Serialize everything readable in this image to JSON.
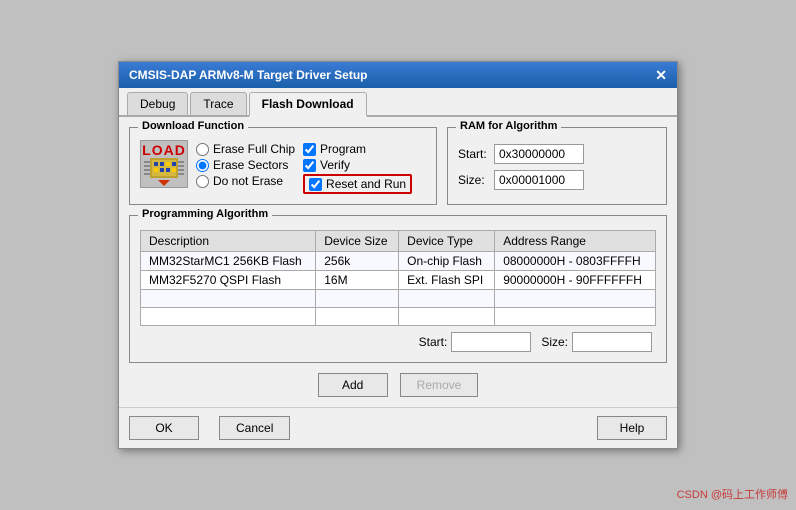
{
  "dialog": {
    "title": "CMSIS-DAP ARMv8-M Target Driver Setup",
    "close_label": "✕"
  },
  "tabs": [
    {
      "label": "Debug",
      "active": false
    },
    {
      "label": "Trace",
      "active": false
    },
    {
      "label": "Flash Download",
      "active": true
    }
  ],
  "download_function": {
    "group_label": "Download Function",
    "load_label": "LOAD",
    "radio_options": [
      {
        "id": "erase_chip",
        "label": "Erase Full Chip",
        "checked": false
      },
      {
        "id": "erase_sectors",
        "label": "Erase Sectors",
        "checked": true
      },
      {
        "id": "do_not_erase",
        "label": "Do not Erase",
        "checked": false
      }
    ],
    "checkboxes": [
      {
        "id": "program",
        "label": "Program",
        "checked": true
      },
      {
        "id": "verify",
        "label": "Verify",
        "checked": true
      }
    ],
    "reset_run": {
      "label": "Reset and Run",
      "checked": true
    }
  },
  "ram_algorithm": {
    "group_label": "RAM for Algorithm",
    "start_label": "Start:",
    "start_value": "0x30000000",
    "size_label": "Size:",
    "size_value": "0x00001000"
  },
  "programming_algorithm": {
    "group_label": "Programming Algorithm",
    "columns": [
      "Description",
      "Device Size",
      "Device Type",
      "Address Range"
    ],
    "rows": [
      {
        "description": "MM32StarMC1 256KB Flash",
        "device_size": "256k",
        "device_type": "On-chip Flash",
        "address_range": "08000000H - 0803FFFFH"
      },
      {
        "description": "MM32F5270 QSPI Flash",
        "device_size": "16M",
        "device_type": "Ext. Flash SPI",
        "address_range": "90000000H - 90FFFFFFH"
      }
    ],
    "start_label": "Start:",
    "size_label": "Size:"
  },
  "buttons": {
    "add_label": "Add",
    "remove_label": "Remove"
  },
  "footer": {
    "ok_label": "OK",
    "cancel_label": "Cancel",
    "help_label": "Help"
  },
  "watermark": "CSDN @码上工作师傅"
}
